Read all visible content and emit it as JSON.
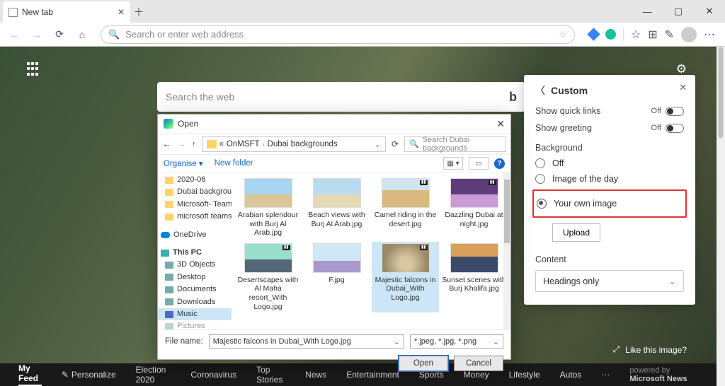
{
  "titlebar": {
    "tab_label": "New tab"
  },
  "addressbar": {
    "placeholder": "Search or enter web address"
  },
  "bing": {
    "placeholder": "Search the web"
  },
  "like": {
    "label": "Like this image?"
  },
  "feed": {
    "items": [
      "My Feed",
      "Personalize",
      "Election 2020",
      "Coronavirus",
      "Top Stories",
      "News",
      "Entertainment",
      "Sports",
      "Money",
      "Lifestyle",
      "Autos"
    ],
    "active_index": 0,
    "powered_prefix": "powered by",
    "powered_brand": "Microsoft News"
  },
  "panel": {
    "title": "Custom",
    "quick_links": {
      "label": "Show quick links",
      "state": "Off"
    },
    "greeting": {
      "label": "Show greeting",
      "state": "Off"
    },
    "background_label": "Background",
    "bg_options": {
      "off": "Off",
      "image_of_day": "Image of the day",
      "own": "Your own image"
    },
    "upload": "Upload",
    "content_label": "Content",
    "content_value": "Headings only"
  },
  "dialog": {
    "title": "Open",
    "path_root": "OnMSFT",
    "path_cur": "Dubai backgrounds",
    "search_placeholder": "Search Dubai backgrounds",
    "organise": "Organise",
    "new_folder": "New folder",
    "tree": {
      "f1": "2020-06",
      "f2": "Dubai backgrou",
      "f3": "Microsoft- Team",
      "f4": "microsoft teams",
      "onedrive": "OneDrive",
      "thispc": "This PC",
      "objects3d": "3D Objects",
      "desktop": "Desktop",
      "documents": "Documents",
      "downloads": "Downloads",
      "music": "Music",
      "pictures": "Pictures"
    },
    "files": [
      {
        "name": "Arabian splendour with Burj Al Arab.jpg",
        "thumb": "t-sky",
        "logo": false,
        "id": "arabian"
      },
      {
        "name": "Beach views with Burj Al Arab.jpg",
        "thumb": "t-beach",
        "logo": false,
        "id": "beach"
      },
      {
        "name": "Camel riding in the desert.jpg",
        "thumb": "t-desert",
        "logo": true,
        "id": "camel"
      },
      {
        "name": "Dazzling Dubai at night.jpg",
        "thumb": "t-night",
        "logo": true,
        "id": "dazzling"
      },
      {
        "name": "Desertscapes with Al Maha resort_With Logo.jpg",
        "thumb": "t-pool",
        "logo": true,
        "id": "desertscapes"
      },
      {
        "name": "F.jpg",
        "thumb": "t-burj",
        "logo": false,
        "id": "f"
      },
      {
        "name": "Majestic falcons in Dubai_With Logo.jpg",
        "thumb": "t-falcon",
        "logo": true,
        "id": "falcon"
      },
      {
        "name": "Sunset scenes with Burj Khalifa.jpg",
        "thumb": "t-sunset",
        "logo": false,
        "id": "sunset"
      }
    ],
    "selected_index": 6,
    "filename_label": "File name:",
    "filename_value": "Majestic falcons in Dubai_With Logo.jpg",
    "filetype_value": "*.jpeg, *.jpg, *.png",
    "open_btn": "Open",
    "cancel_btn": "Cancel"
  }
}
